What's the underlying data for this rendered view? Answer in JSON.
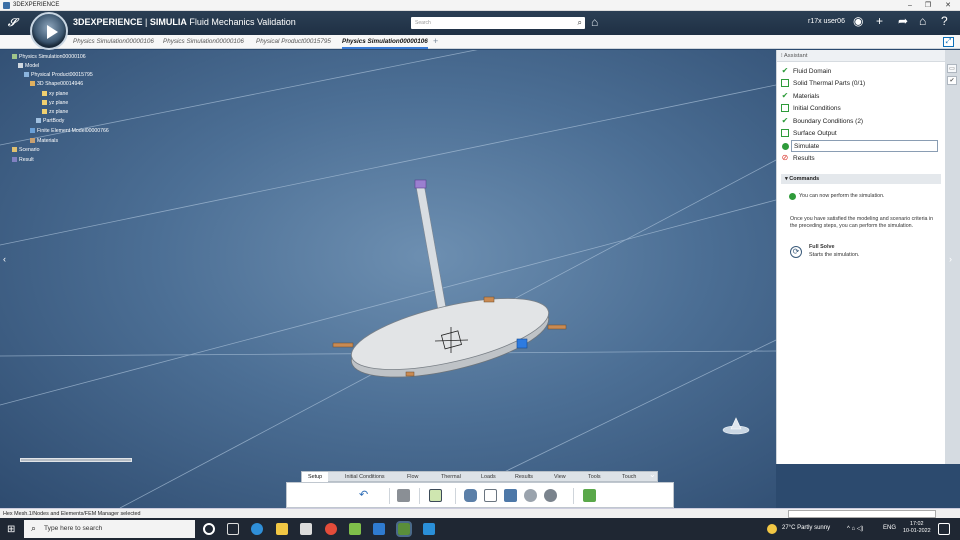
{
  "window": {
    "title": "3DEXPERIENCE",
    "controls": [
      "–",
      "❐",
      "✕"
    ]
  },
  "header": {
    "brand": "3DEXPERIENCE",
    "separator": "|",
    "product": "SIMULIA",
    "app_name": "Fluid Mechanics Validation",
    "search_placeholder": "Search",
    "user": "r17x user06",
    "icons": [
      "tag-icon",
      "user-avatar-icon",
      "plus-icon",
      "share-icon",
      "home-icon",
      "help-icon"
    ]
  },
  "tabs": [
    {
      "label": "Physics Simulation00000106",
      "active": false
    },
    {
      "label": "Physics Simulation00000106",
      "active": false
    },
    {
      "label": "Physical Product00015795",
      "active": false
    },
    {
      "label": "Physics Simulation00000106",
      "active": true
    }
  ],
  "tree": {
    "root": "Physics Simulation00000106",
    "model": "Model",
    "physical_product": "Physical Product00015795",
    "shape": "3D Shape00014946",
    "xy": "xy plane",
    "yz": "yz plane",
    "zx": "zx plane",
    "partbody": "PartBody",
    "fem": "Finite Element Model00000766",
    "materials": "Materials",
    "scenario": "Scenario",
    "result": "Result"
  },
  "assistant": {
    "title": "Assistant",
    "steps": [
      {
        "label": "Fluid Domain",
        "status": "done"
      },
      {
        "label": "Solid Thermal Parts (0/1)",
        "status": "todo"
      },
      {
        "label": "Materials",
        "status": "done"
      },
      {
        "label": "Initial Conditions",
        "status": "todo"
      },
      {
        "label": "Boundary Conditions (2)",
        "status": "done"
      },
      {
        "label": "Surface Output",
        "status": "todo"
      },
      {
        "label": "Simulate",
        "status": "current"
      },
      {
        "label": "Results",
        "status": "blocked"
      }
    ],
    "commands_title": "Commands",
    "msg1": "You can now perform the simulation.",
    "msg2": "Once you have satisfied the modeling and scenario criteria in the preceding steps, you can perform the simulation.",
    "full_solve_title": "Full Solve",
    "full_solve_desc": "Starts the simulation."
  },
  "action_bar": {
    "tabs": [
      "Setup",
      "Initial Conditions",
      "Flow",
      "Thermal",
      "Loads",
      "Results",
      "View",
      "Tools",
      "Touch"
    ],
    "active_tab": "Setup"
  },
  "status_bar": {
    "text": "Hex Mesh.1/Nodes and Elements/FEM Manager selected"
  },
  "taskbar": {
    "search_placeholder": "Type here to search",
    "weather": "27°C  Partly sunny",
    "lang": "ENG",
    "time": "17:02",
    "date": "10-01-2022"
  },
  "colors": {
    "header_bg": "#22364a",
    "viewport_bg": "#4c6f95",
    "check_green": "#2e9b3a",
    "selection_blue": "#2e7bd1"
  }
}
